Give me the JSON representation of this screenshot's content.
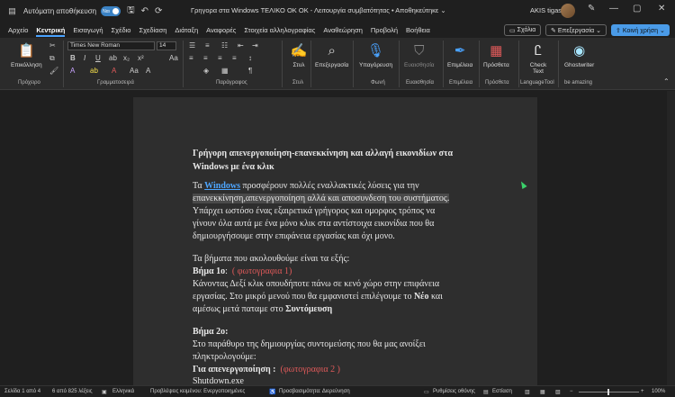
{
  "titlebar": {
    "autosave_label": "Αυτόματη αποθήκευση",
    "autosave_state": "Ναι",
    "doc_title": "Γρηγορα στα Windows ΤΕΛΙΚΟ ΟΚ ΟΚ  -  Λειτουργία συμβατότητας  •  Αποθηκεύτηκε  ⌄",
    "user_name": "AKIS tigas"
  },
  "menu": {
    "items": [
      "Αρχείο",
      "Κεντρική",
      "Εισαγωγή",
      "Σχέδιο",
      "Σχεδίαση",
      "Διάταξη",
      "Αναφορές",
      "Στοιχεία αλληλογραφίας",
      "Αναθεώρηση",
      "Προβολή",
      "Βοήθεια"
    ],
    "active": "Κεντρική",
    "comments": "Σχόλια",
    "editing": "Επεξεργασία ⌄",
    "share": "Κοινή χρήση ⌄"
  },
  "ribbon": {
    "paste_label": "Επικόλληση",
    "font_name": "Times New Roman",
    "font_size": "14",
    "style_label": "Στυλ",
    "find_label": "Επεξεργασία",
    "dictate_label": "Υπαγόρευση",
    "sensitivity_label": "Ευαισθησία",
    "editor_label": "Επιμέλεια",
    "addins_label": "Πρόσθετα",
    "checktext_label": "Check Text",
    "ghostwriter_label": "Ghostwriter",
    "groups": {
      "clipboard": "Πρόχειρο",
      "font": "Γραμματοσειρά",
      "paragraph": "Παράγραφος",
      "styles": "Στυλ",
      "voice": "Φωνή",
      "sensitivity": "Ευαισθησία",
      "editor": "Επιμέλεια",
      "addins": "Πρόσθετα",
      "languagetool": "LanguageTool",
      "ghost": "be amazing"
    }
  },
  "document": {
    "heading1": "Γρήγορη απενεργοποίηση-επανεκκίνηση και αλλαγή εικονιδίων στα",
    "heading2": "Windows με ένα κλικ",
    "p1_pre": "Τα ",
    "p1_link": "Windows",
    "p1_post": "  προσφέρουν πολλές εναλλακτικές λύσεις για την",
    "p1_line2": "επανεκκίνηση,απενεργοποίηση αλλά και αποσυνδεση του συστήματος.",
    "p1_line3": "Υπάρχει ωστόσο ένας εξαιρετικά γρήγορος και ομορφος τρόπος να",
    "p1_line4": "γίνουν όλα αυτά με ένα μόνο κλικ στα αντίστοιχα εικονίδια που  θα",
    "p1_line5": "δημιουργήσουμε στην επιφάνεια εργασίας και όχι μονο.",
    "steps_intro": "Τα βήματα  που ακολουθούμε είναι τα εξής:",
    "step1_label": "Βήμα 1ο",
    "step1_photo": "( φωτογραφια 1)",
    "step1_l1": "Κάνοντας Δεξί κλικ οπουδήποτε πάνω σε κενό χώρο στην επιφάνεια",
    "step1_l2_pre": "εργασίας. Στο μικρό μενού που θα εμφανιστεί επιλέγουμε το ",
    "step1_l2_bold": "Νέο",
    "step1_l2_post": " και",
    "step1_l3_pre": "αμέσως μετά παταμε στο ",
    "step1_l3_bold": "Συντόμευση",
    "step2_label": "Βήμα 2ο:",
    "step2_l1": "Στο παράθυρο της δημιουργίας συντομεύσης που θα μας ανοίξει",
    "step2_l2": "πληκτρολογούμε:",
    "shutdown_label": "Για απενεργοποίηση  :",
    "shutdown_photo": "(φωτογραφια 2 )",
    "shutdown_cmd": "Shutdown.exe"
  },
  "status": {
    "page": "Σελίδα 1 από 4",
    "words": "6 από 825 λέξεις",
    "language": "Ελληνικά",
    "predictions": "Προβλέψεις κειμένου: Ενεργοποιημένες",
    "accessibility": "Προσβασιμότητα: Διερεύνηση",
    "display": "Ρυθμίσεις οθόνης",
    "focus": "Εστίαση",
    "zoom": "100%"
  }
}
